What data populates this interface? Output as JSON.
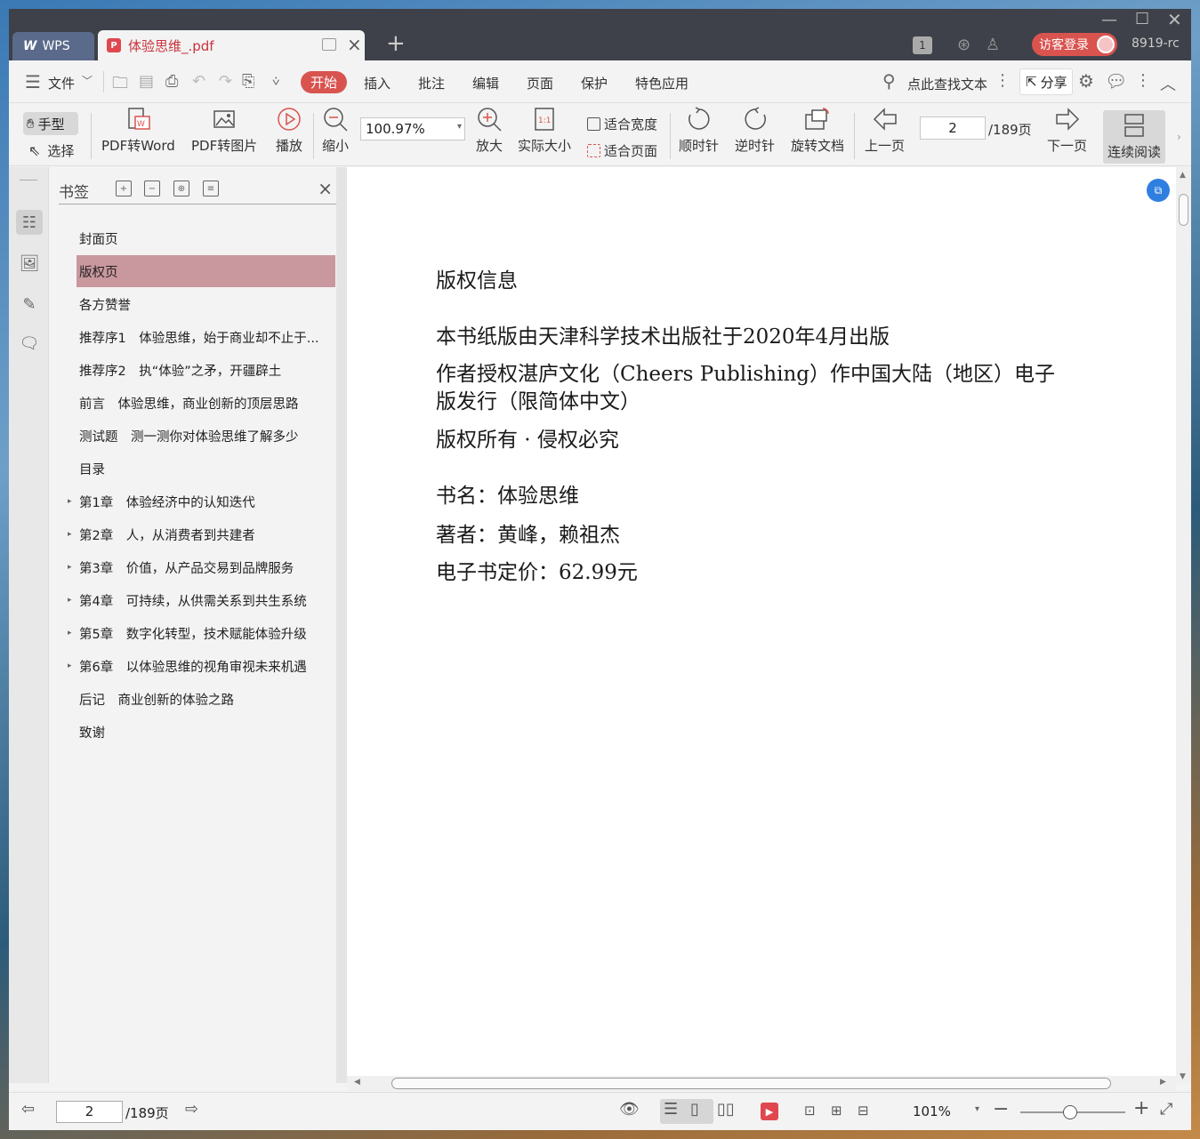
{
  "titlebar": {
    "app_tab": "WPS",
    "doc_tab": "体验思维_.pdf",
    "page_indicator": "1",
    "login": "访客登录",
    "version": "8919-rc"
  },
  "menu": {
    "file": "文件",
    "tabs": [
      "开始",
      "插入",
      "批注",
      "编辑",
      "页面",
      "保护",
      "特色应用"
    ],
    "search": "点此查找文本",
    "share": "分享"
  },
  "ribbon": {
    "hand": "手型",
    "select": "选择",
    "pdf_to_word": "PDF转Word",
    "pdf_to_image": "PDF转图片",
    "play": "播放",
    "zoom_out": "缩小",
    "zoom_value": "100.97%",
    "zoom_in": "放大",
    "actual_size": "实际大小",
    "fit_width": "适合宽度",
    "fit_page": "适合页面",
    "clockwise": "顺时针",
    "counterclockwise": "逆时针",
    "rotate_doc": "旋转文档",
    "prev_page": "上一页",
    "page_input": "2",
    "page_total": "/189页",
    "next_page": "下一页",
    "continuous": "连续阅读"
  },
  "bookmarks": {
    "title": "书签",
    "items": [
      {
        "label": "封面页",
        "expandable": false,
        "selected": false
      },
      {
        "label": "版权页",
        "expandable": false,
        "selected": true
      },
      {
        "label": "各方赞誉",
        "expandable": false,
        "selected": false
      },
      {
        "label": "推荐序1　体验思维，始于商业却不止于...",
        "expandable": false,
        "selected": false
      },
      {
        "label": "推荐序2　执“体验”之矛，开疆辟土",
        "expandable": false,
        "selected": false
      },
      {
        "label": "前言　体验思维，商业创新的顶层思路",
        "expandable": false,
        "selected": false
      },
      {
        "label": "测试题　测一测你对体验思维了解多少",
        "expandable": false,
        "selected": false
      },
      {
        "label": "目录",
        "expandable": false,
        "selected": false
      },
      {
        "label": "第1章　体验经济中的认知迭代",
        "expandable": true,
        "selected": false
      },
      {
        "label": "第2章　人，从消费者到共建者",
        "expandable": true,
        "selected": false
      },
      {
        "label": "第3章　价值，从产品交易到品牌服务",
        "expandable": true,
        "selected": false
      },
      {
        "label": "第4章　可持续，从供需关系到共生系统",
        "expandable": true,
        "selected": false
      },
      {
        "label": "第5章　数字化转型，技术赋能体验升级",
        "expandable": true,
        "selected": false
      },
      {
        "label": "第6章　以体验思维的视角审视未来机遇",
        "expandable": true,
        "selected": false
      },
      {
        "label": "后记　商业创新的体验之路",
        "expandable": false,
        "selected": false
      },
      {
        "label": "致谢",
        "expandable": false,
        "selected": false
      }
    ]
  },
  "document": {
    "heading": "版权信息",
    "lines": [
      "本书纸版由天津科学技术出版社于2020年4月出版",
      "作者授权湛庐文化（Cheers Publishing）作中国大陆（地区）电子",
      "版发行（限简体中文）",
      "版权所有 · 侵权必究",
      "书名：体验思维",
      "著者：黄峰，赖祖杰",
      "电子书定价：62.99元"
    ]
  },
  "statusbar": {
    "page_input": "2",
    "page_total": "/189页",
    "zoom": "101%"
  },
  "colors": {
    "accent": "#d9534f",
    "selected_bookmark": "#c9979e",
    "titlebar": "#3e4149"
  }
}
